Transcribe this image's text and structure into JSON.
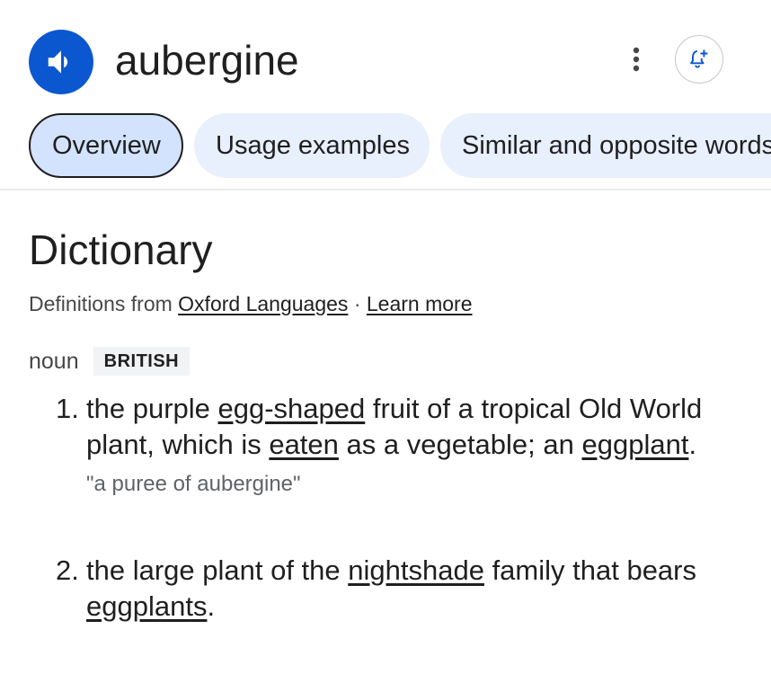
{
  "header": {
    "word": "aubergine",
    "speaker_icon": "speaker-icon",
    "more_icon": "more-vert-icon",
    "alert_icon": "add-alert-icon",
    "accent": "#0b57d0"
  },
  "tabs": [
    {
      "label": "Overview",
      "active": true
    },
    {
      "label": "Usage examples",
      "active": false
    },
    {
      "label": "Similar and opposite words",
      "active": false
    }
  ],
  "dictionary": {
    "title": "Dictionary",
    "source_prefix": "Definitions from",
    "source_link": "Oxford Languages",
    "separator": "·",
    "learn_more": "Learn more",
    "part_of_speech": "noun",
    "region": "BRITISH",
    "definitions": [
      {
        "number": "1.",
        "parts": [
          {
            "t": "the purple "
          },
          {
            "t": "egg-shaped",
            "link": true
          },
          {
            "t": " fruit of a tropical Old World plant, which is "
          },
          {
            "t": "eaten",
            "link": true
          },
          {
            "t": " as a vegetable; an "
          },
          {
            "t": "eggplant",
            "link": true
          },
          {
            "t": "."
          }
        ],
        "example": "\"a puree of aubergine\""
      },
      {
        "number": "2.",
        "parts": [
          {
            "t": "the large plant of the "
          },
          {
            "t": "nightshade",
            "link": true
          },
          {
            "t": " family that bears "
          },
          {
            "t": "eggplants",
            "link": true
          },
          {
            "t": "."
          }
        ]
      }
    ]
  }
}
